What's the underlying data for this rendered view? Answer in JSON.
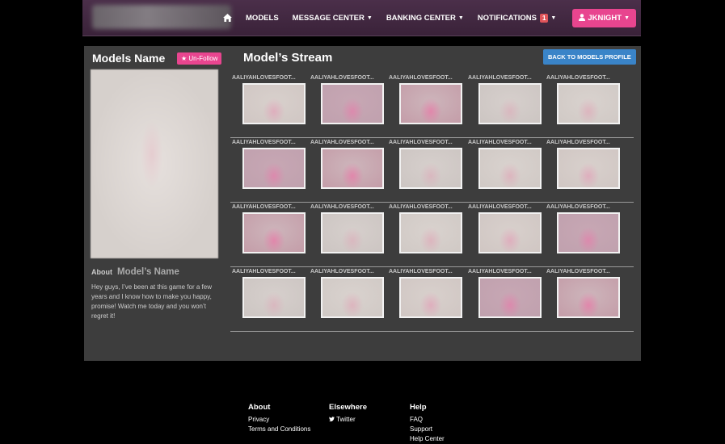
{
  "nav": {
    "home_icon": "home-icon",
    "items": [
      {
        "label": "MODELS",
        "caret": false
      },
      {
        "label": "MESSAGE CENTER",
        "caret": true
      },
      {
        "label": "BANKING CENTER",
        "caret": true
      },
      {
        "label": "NOTIFICATIONS",
        "caret": true,
        "badge": "1"
      }
    ],
    "user_label": "JKNIGHT",
    "colors": {
      "bar": "#3f2740",
      "user_btn": "#e8458f"
    }
  },
  "sidebar": {
    "title": "Models Name",
    "unfollow_label": "Un-Follow",
    "about_label": "About",
    "about_name": "Model’s Name",
    "bio": "Hey guys, I’ve been at this game for a few years and I know how to make you happy, promise! Watch me today and you won’t regret it!"
  },
  "stream": {
    "title": "Model’s Stream",
    "back_label": "BACK TO MODELS PROFILE",
    "rows": [
      {
        "cells": [
          {
            "label": "AALIYAHLOVESFOOT..."
          },
          {
            "label": "AALIYAHLOVESFOOT..."
          },
          {
            "label": "AALIYAHLOVESFOOT..."
          },
          {
            "label": "AALIYAHLOVESFOOT..."
          },
          {
            "label": "AALIYAHLOVESFOOT..."
          }
        ]
      },
      {
        "cells": [
          {
            "label": "AALIYAHLOVESFOOT..."
          },
          {
            "label": "AALIYAHLOVESFOOT..."
          },
          {
            "label": "AALIYAHLOVESFOOT..."
          },
          {
            "label": "AALIYAHLOVESFOOT..."
          },
          {
            "label": "AALIYAHLOVESFOOT..."
          }
        ]
      },
      {
        "cells": [
          {
            "label": "AALIYAHLOVESFOOT..."
          },
          {
            "label": "AALIYAHLOVESFOOT..."
          },
          {
            "label": "AALIYAHLOVESFOOT..."
          },
          {
            "label": "AALIYAHLOVESFOOT..."
          },
          {
            "label": "AALIYAHLOVESFOOT..."
          }
        ]
      },
      {
        "cells": [
          {
            "label": "AALIYAHLOVESFOOT..."
          },
          {
            "label": "AALIYAHLOVESFOOT..."
          },
          {
            "label": "AALIYAHLOVESFOOT..."
          },
          {
            "label": "AALIYAHLOVESFOOT..."
          },
          {
            "label": "AALIYAHLOVESFOOT..."
          }
        ]
      }
    ]
  },
  "footer": {
    "columns": [
      {
        "heading": "About",
        "links": [
          "Privacy",
          "Terms and Conditions"
        ]
      },
      {
        "heading": "Elsewhere",
        "links": [
          "Twitter"
        ]
      },
      {
        "heading": "Help",
        "links": [
          "FAQ",
          "Support",
          "Help Center"
        ]
      }
    ]
  }
}
